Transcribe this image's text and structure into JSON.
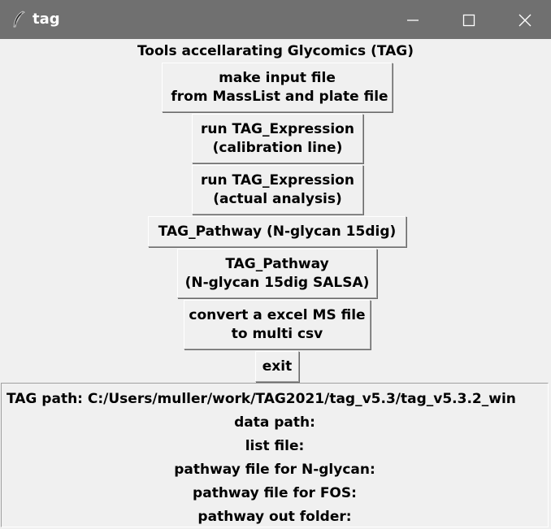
{
  "window": {
    "title": "tag",
    "icon": "feather-icon"
  },
  "heading": "Tools accellarating Glycomics (TAG)",
  "buttons": {
    "make_input": {
      "line1": "make input file",
      "line2": " from MassList and plate file"
    },
    "run_calib": {
      "line1": "run TAG_Expression",
      "line2": "(calibration line)"
    },
    "run_actual": {
      "line1": "run TAG_Expression",
      "line2": "(actual analysis)"
    },
    "pathway15": {
      "line1": "TAG_Pathway (N-glycan 15dig)"
    },
    "pathway15salsa": {
      "line1": "TAG_Pathway",
      "line2": "(N-glycan 15dig SALSA)"
    },
    "convert": {
      "line1": "convert a excel MS file",
      "line2": "to multi csv"
    },
    "exit": {
      "line1": "exit"
    }
  },
  "info": {
    "tag_path": "TAG path:  C:/Users/muller/work/TAG2021/tag_v5.3/tag_v5.3.2_win",
    "data_path": "data path:",
    "list_file": "list file:",
    "pathway_nglycan": "pathway file for N-glycan:",
    "pathway_fos": "pathway file for FOS:",
    "pathway_out": "pathway out folder:"
  }
}
